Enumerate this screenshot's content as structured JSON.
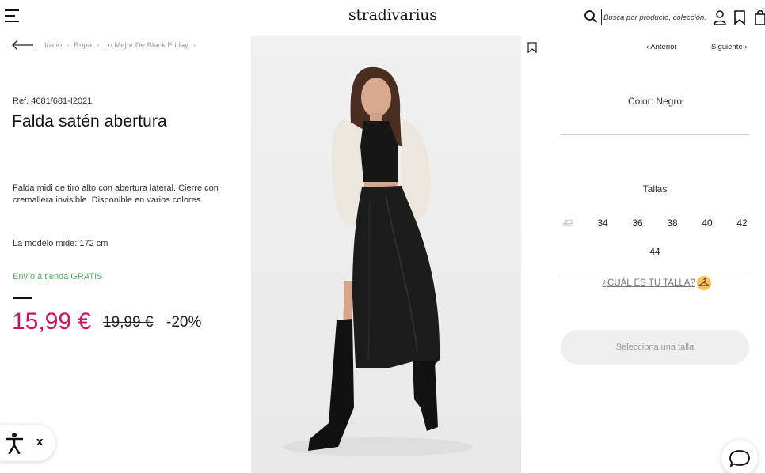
{
  "header": {
    "logo": "stradivarius",
    "search_placeholder": "Busca por producto, colección..."
  },
  "breadcrumb": {
    "items": [
      "Inicio",
      "Ropa",
      "Lo Mejor De Black Friday"
    ],
    "separator": "›"
  },
  "product": {
    "ref": "Ref. 4681/681-I2021",
    "title": "Falda satén abertura",
    "description": "Falda midi de tiro alto con abertura lateral. Cierre con cremallera invisible. Disponible en varios colores.",
    "model_info": "La modelo mide: 172 cm",
    "shipping": "Envío a tienda GRATIS",
    "price": "15,99 €",
    "old_price": "19,99 €",
    "discount": "-20%"
  },
  "nav": {
    "prev": "Anterior",
    "next": "Siguiente"
  },
  "options": {
    "color_label": "Color: Negro",
    "sizes_title": "Tallas",
    "sizes": [
      "32",
      "34",
      "36",
      "38",
      "40",
      "42",
      "44"
    ],
    "size_guide": "¿CUÁL ES TU TALLA?",
    "select_button": "Selecciona una talla"
  },
  "colors": {
    "price": "#c5165e",
    "shipping": "#5aa86a",
    "guide_badge": "#f5c15c"
  },
  "accessibility": {
    "close_label": "x"
  }
}
